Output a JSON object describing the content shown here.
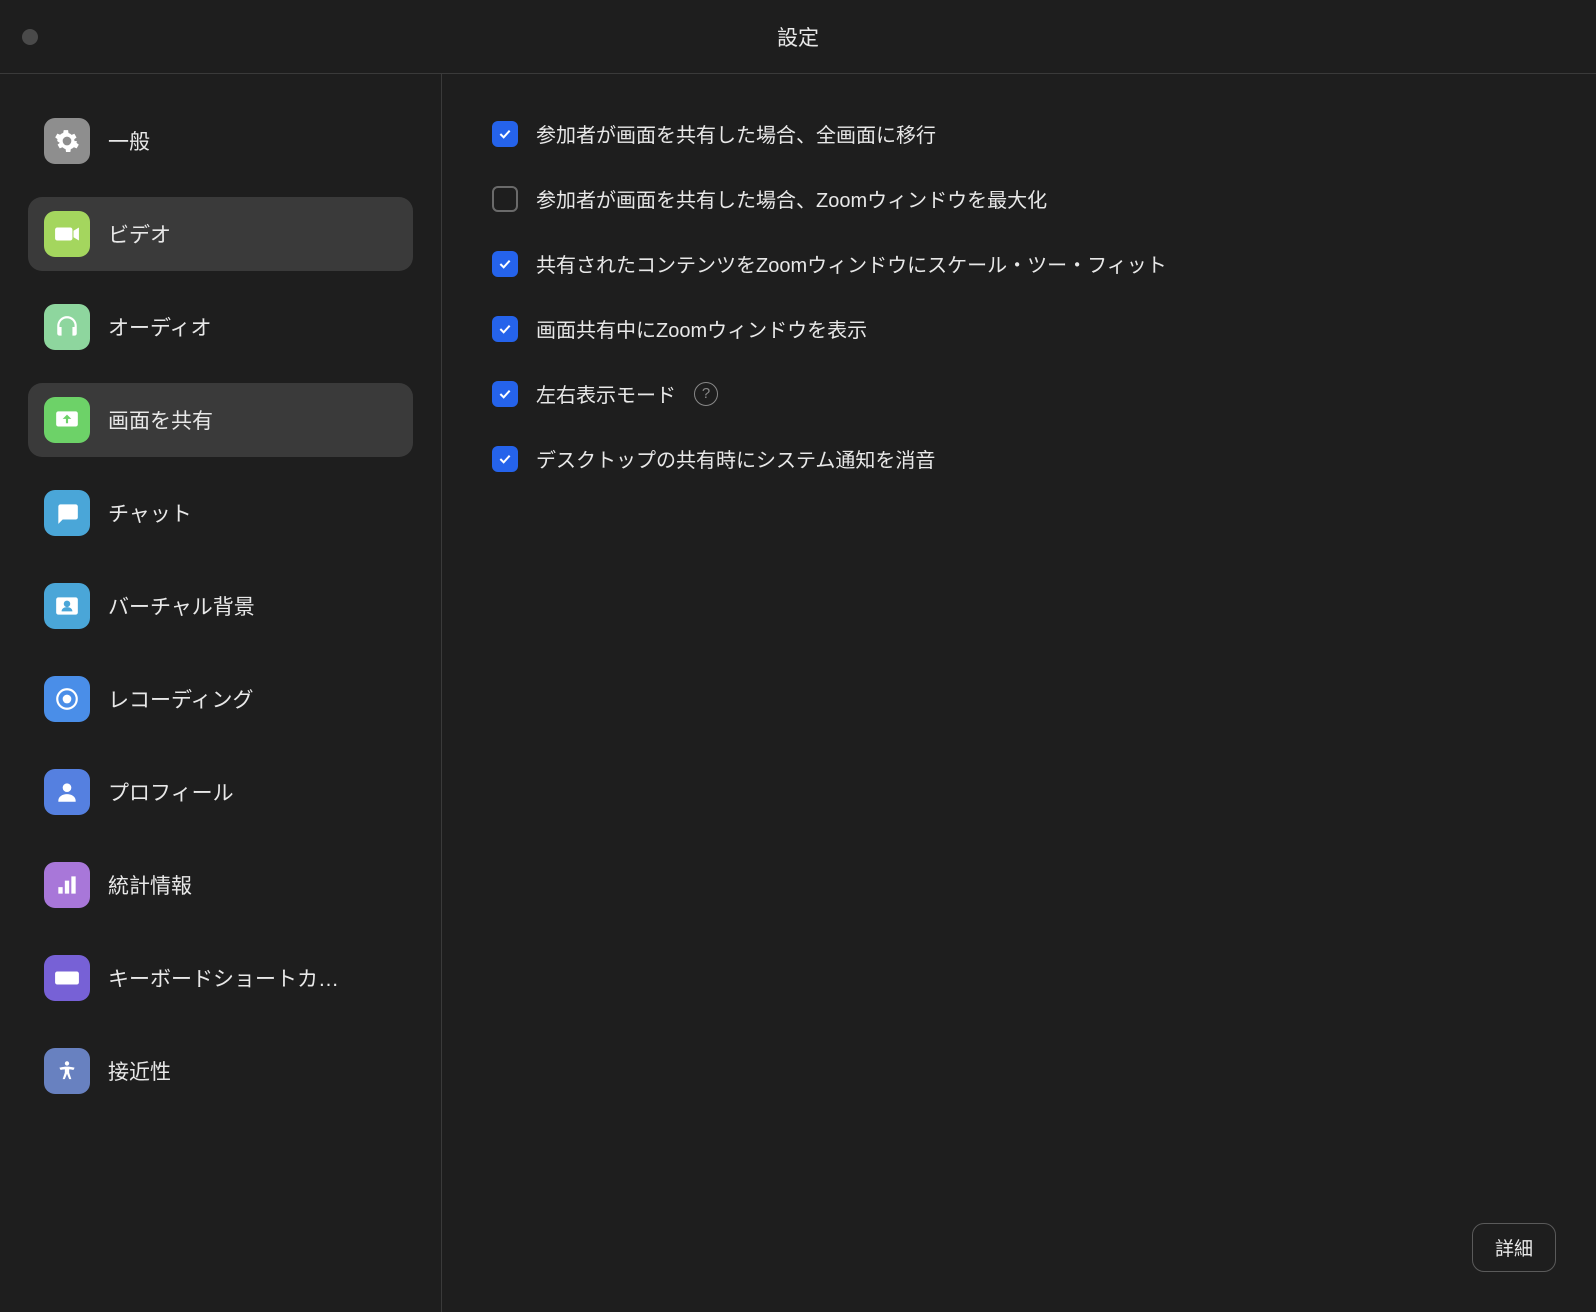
{
  "window": {
    "title": "設定"
  },
  "sidebar": {
    "items": [
      {
        "id": "general",
        "label": "一般",
        "selected": false
      },
      {
        "id": "video",
        "label": "ビデオ",
        "selected": true
      },
      {
        "id": "audio",
        "label": "オーディオ",
        "selected": false
      },
      {
        "id": "share",
        "label": "画面を共有",
        "selected": true
      },
      {
        "id": "chat",
        "label": "チャット",
        "selected": false
      },
      {
        "id": "vbg",
        "label": "バーチャル背景",
        "selected": false
      },
      {
        "id": "recording",
        "label": "レコーディング",
        "selected": false
      },
      {
        "id": "profile",
        "label": "プロフィール",
        "selected": false
      },
      {
        "id": "stats",
        "label": "統計情報",
        "selected": false
      },
      {
        "id": "keyboard",
        "label": "キーボードショートカ…",
        "selected": false
      },
      {
        "id": "accessibility",
        "label": "接近性",
        "selected": false
      }
    ]
  },
  "main": {
    "options": [
      {
        "label": "参加者が画面を共有した場合、全画面に移行",
        "checked": true,
        "help": false
      },
      {
        "label": "参加者が画面を共有した場合、Zoomウィンドウを最大化",
        "checked": false,
        "help": false
      },
      {
        "label": "共有されたコンテンツをZoomウィンドウにスケール・ツー・フィット",
        "checked": true,
        "help": false
      },
      {
        "label": "画面共有中にZoomウィンドウを表示",
        "checked": true,
        "help": false
      },
      {
        "label": "左右表示モード",
        "checked": true,
        "help": true
      },
      {
        "label": "デスクトップの共有時にシステム通知を消音",
        "checked": true,
        "help": false
      }
    ],
    "advanced_button": "詳細"
  }
}
